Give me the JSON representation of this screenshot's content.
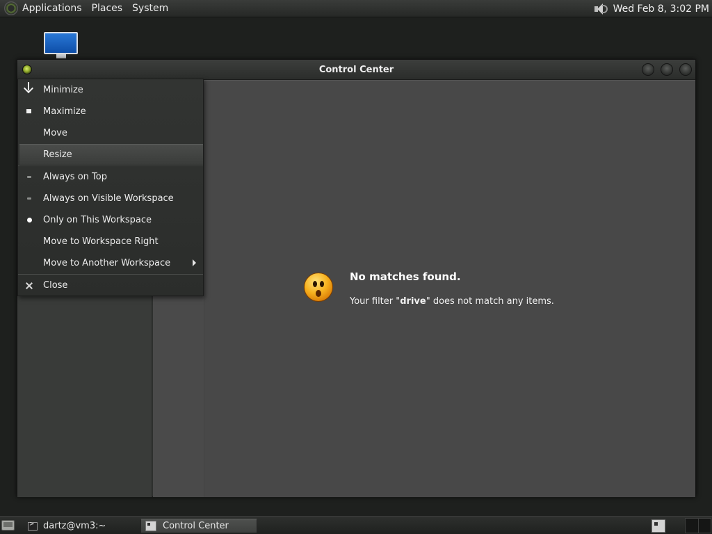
{
  "top_panel": {
    "menus": [
      "Applications",
      "Places",
      "System"
    ],
    "clock": "Wed Feb  8,  3:02 PM"
  },
  "window": {
    "title": "Control Center",
    "empty_state": {
      "title": "No matches found.",
      "detail_prefix": "Your filter \"",
      "filter_term": "drive",
      "detail_suffix": "\" does not match any items."
    }
  },
  "window_menu": {
    "items": [
      {
        "label": "Minimize",
        "icon": "minimize-icon"
      },
      {
        "label": "Maximize",
        "icon": "maximize-icon"
      },
      {
        "label": "Move",
        "icon": ""
      },
      {
        "label": "Resize",
        "icon": "",
        "highlighted": true
      },
      {
        "label": "Always on Top",
        "icon": "unchecked-indicator"
      },
      {
        "label": "Always on Visible Workspace",
        "icon": "unchecked-indicator"
      },
      {
        "label": "Only on This Workspace",
        "icon": "radio-selected-icon"
      },
      {
        "label": "Move to Workspace Right",
        "icon": ""
      },
      {
        "label": "Move to Another Workspace",
        "icon": "",
        "submenu": true
      },
      {
        "label": "Close",
        "icon": "close-icon"
      }
    ]
  },
  "taskbar": {
    "tasks": [
      {
        "label": "dartz@vm3:~",
        "icon": "terminal-icon",
        "active": false
      },
      {
        "label": "Control Center",
        "icon": "control-center-icon",
        "active": true
      }
    ]
  }
}
